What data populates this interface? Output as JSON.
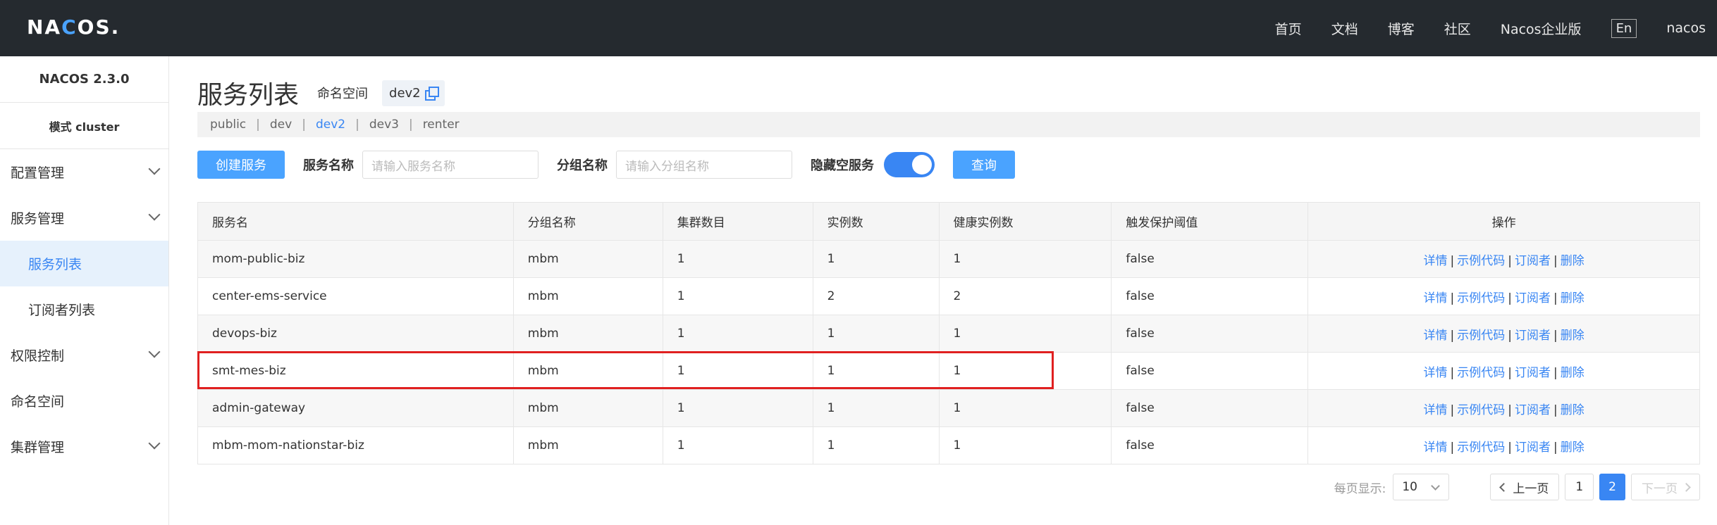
{
  "header": {
    "logo": "NACOS.",
    "nav": [
      "首页",
      "文档",
      "博客",
      "社区",
      "Nacos企业版"
    ],
    "lang": "En",
    "user": "nacos"
  },
  "sidebar": {
    "version": "NACOS 2.3.0",
    "mode": "模式 cluster",
    "items": [
      {
        "label": "配置管理"
      },
      {
        "label": "服务管理"
      },
      {
        "label": "服务列表"
      },
      {
        "label": "订阅者列表"
      },
      {
        "label": "权限控制"
      },
      {
        "label": "命名空间"
      },
      {
        "label": "集群管理"
      }
    ]
  },
  "main": {
    "title": "服务列表",
    "namespace_label": "命名空间",
    "namespace_value": "dev2",
    "namespaces": [
      "public",
      "dev",
      "dev2",
      "dev3",
      "renter"
    ],
    "create_button": "创建服务",
    "service_name_label": "服务名称",
    "service_name_placeholder": "请输入服务名称",
    "group_name_label": "分组名称",
    "group_name_placeholder": "请输入分组名称",
    "hide_empty_label": "隐藏空服务",
    "hide_empty_on": true,
    "query_button": "查询"
  },
  "table": {
    "columns": [
      "服务名",
      "分组名称",
      "集群数目",
      "实例数",
      "健康实例数",
      "触发保护阈值",
      "操作"
    ],
    "actions": [
      "详情",
      "示例代码",
      "订阅者",
      "删除"
    ],
    "rows": [
      [
        "mom-public-biz",
        "mbm",
        "1",
        "1",
        "1",
        "false"
      ],
      [
        "center-ems-service",
        "mbm",
        "1",
        "2",
        "2",
        "false"
      ],
      [
        "devops-biz",
        "mbm",
        "1",
        "1",
        "1",
        "false"
      ],
      [
        "smt-mes-biz",
        "mbm",
        "1",
        "1",
        "1",
        "false"
      ],
      [
        "admin-gateway",
        "mbm",
        "1",
        "1",
        "1",
        "false"
      ],
      [
        "mbm-mom-nationstar-biz",
        "mbm",
        "1",
        "1",
        "1",
        "false"
      ]
    ]
  },
  "pagination": {
    "per_page_label": "每页显示:",
    "per_page": "10",
    "prev": "上一页",
    "pages": [
      "1",
      "2"
    ],
    "current": "2",
    "next": "下一页"
  },
  "colors": {
    "accent": "#3986f3",
    "header_bg": "#252a2f",
    "highlight": "#e02020"
  }
}
